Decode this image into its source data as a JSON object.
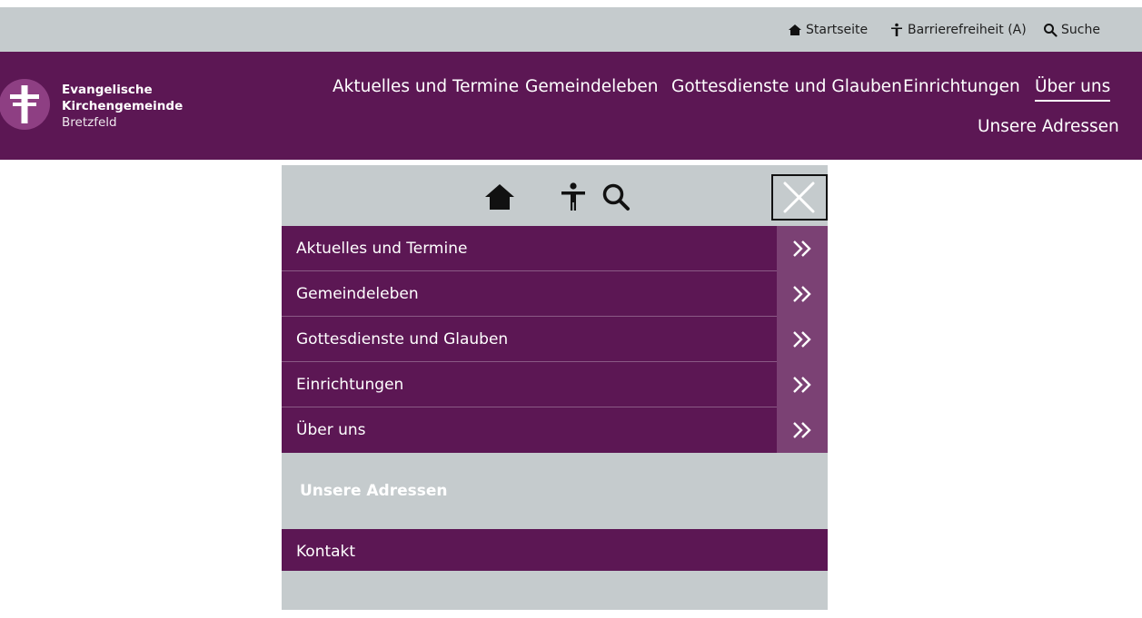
{
  "utility": {
    "home_label": "Startseite",
    "accessibility_label": "Barrierefreiheit (A)",
    "search_label": "Suche"
  },
  "logo": {
    "line1": "Evangelische",
    "line2": "Kirchengemeinde",
    "line3": "Bretzfeld"
  },
  "main_nav": [
    "Aktuelles und Termine",
    "Gemeindeleben",
    "Gottesdienste und Glauben",
    "Einrichtungen",
    "Über uns",
    "Unsere Adressen"
  ],
  "active_nav_item": "Über uns",
  "mobile_menu": {
    "items": [
      "Aktuelles und Termine",
      "Gemeindeleben",
      "Gottesdienste und Glauben",
      "Einrichtungen",
      "Über uns"
    ],
    "sub_heading": "Unsere Adressen",
    "contact": "Kontakt"
  },
  "colors": {
    "brand_purple": "#5c1754",
    "arrow_purple": "#7b4174",
    "gray_bar": "#c5cbcd"
  }
}
